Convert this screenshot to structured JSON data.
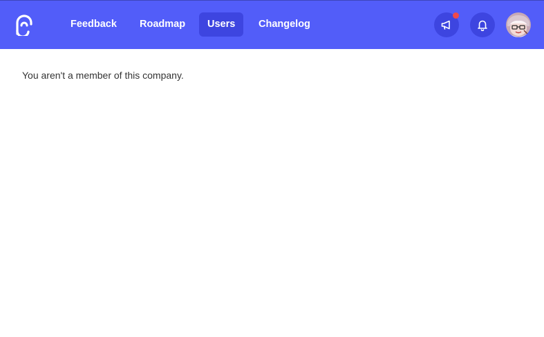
{
  "brand": {
    "logo_icon": "canny-logo-icon",
    "color": "#525df9"
  },
  "nav": {
    "items": [
      {
        "label": "Feedback",
        "active": false
      },
      {
        "label": "Roadmap",
        "active": false
      },
      {
        "label": "Users",
        "active": true
      },
      {
        "label": "Changelog",
        "active": false
      }
    ]
  },
  "header_actions": {
    "announcements_icon": "megaphone-icon",
    "announcements_has_unread": true,
    "notifications_icon": "bell-icon",
    "avatar_icon": "user-avatar"
  },
  "main": {
    "message": "You aren't a member of this company."
  }
}
